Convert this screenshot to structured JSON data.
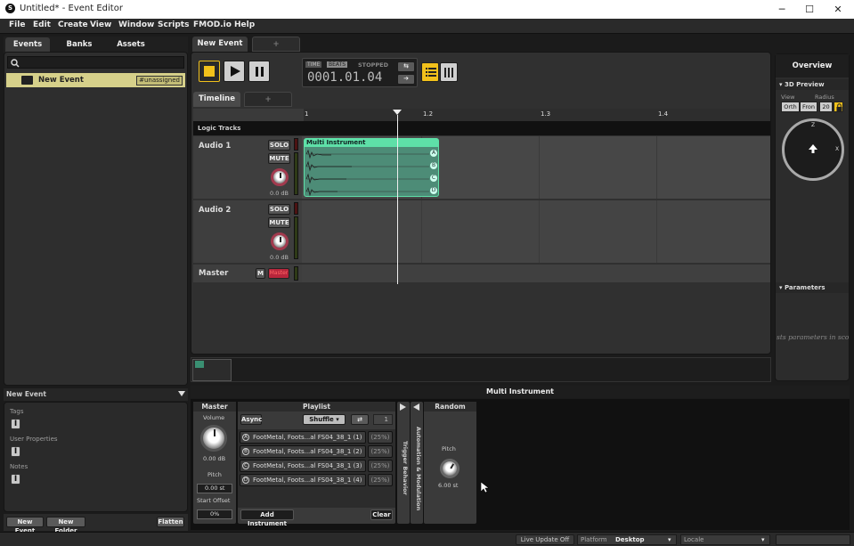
{
  "window": {
    "title": "Untitled* - Event Editor",
    "minimize": "─",
    "maximize": "☐",
    "close": "✕"
  },
  "menu": [
    "File",
    "Edit",
    "Create",
    "View",
    "Window",
    "Scripts",
    "FMOD.io",
    "Help"
  ],
  "browser": {
    "tabs": [
      "Events",
      "Banks",
      "Assets"
    ],
    "search_placeholder": "",
    "events": [
      {
        "name": "New Event",
        "badge": "#unassigned"
      }
    ],
    "properties": {
      "title": "New Event",
      "tags": "Tags",
      "user_properties": "User Properties",
      "notes": "Notes",
      "notes_icon": "I"
    },
    "footer": {
      "new_event": "New Event",
      "new_folder": "New Folder",
      "flatten": "Flatten"
    }
  },
  "editor": {
    "event_tab": "New Event",
    "add_tab": "+",
    "transport": {
      "time_label": "TIME",
      "beats_label": "BEATS",
      "status": "STOPPED",
      "position": "0001.01.04"
    },
    "timeline_tab": "Timeline",
    "timeline_add": "+",
    "ruler": [
      "1",
      "1.2",
      "1.3",
      "1.4"
    ],
    "logic_tracks": "Logic Tracks",
    "tracks": [
      {
        "name": "Audio 1",
        "solo": "SOLO",
        "mute": "MUTE",
        "level": "0.0 dB"
      },
      {
        "name": "Audio 2",
        "solo": "SOLO",
        "mute": "MUTE",
        "level": "0.0 dB"
      }
    ],
    "master": {
      "name": "Master",
      "m": "M",
      "label": "Master"
    },
    "instrument_region": {
      "name": "Multi Instrument",
      "letters": [
        "A",
        "B",
        "C",
        "D"
      ]
    }
  },
  "overview": {
    "title": "Overview",
    "preview_3d": "3D Preview",
    "view_label": "View",
    "radius_label": "Radius",
    "view_btn1": "Orth",
    "view_btn2": "Fron",
    "radius_value": "20",
    "axis_z": "Z",
    "axis_x": "X",
    "parameters": "Parameters",
    "params_hint": "sts parameters in sco"
  },
  "deck": {
    "title": "Multi Instrument",
    "master": {
      "title": "Master",
      "volume_label": "Volume",
      "volume_value": "0.00 dB",
      "pitch_label": "Pitch",
      "pitch_value": "0.00 st",
      "start_offset_label": "Start Offset",
      "start_offset_value": "0%"
    },
    "playlist": {
      "title": "Playlist",
      "async": "Async",
      "mode": "Shuffle",
      "count": "1",
      "items": [
        {
          "letter": "A",
          "name": "FootMetal, Foots...al FS04_38_1 (1)",
          "pct": "(25%)"
        },
        {
          "letter": "B",
          "name": "FootMetal, Foots...al FS04_38_1 (2)",
          "pct": "(25%)"
        },
        {
          "letter": "C",
          "name": "FootMetal, Foots...al FS04_38_1 (3)",
          "pct": "(25%)"
        },
        {
          "letter": "D",
          "name": "FootMetal, Foots...al FS04_38_1 (4)",
          "pct": "(25%)"
        }
      ],
      "add": "Add Instrument",
      "clear": "Clear"
    },
    "trigger": "Trigger Behavior",
    "automation": "Automation & Modulation",
    "random": {
      "title": "Random",
      "pitch_label": "Pitch",
      "pitch_value": "6.00 st"
    }
  },
  "statusbar": {
    "live_update": "Live Update Off",
    "platform_label": "Platform",
    "platform_value": "Desktop",
    "locale_label": "Locale",
    "locale_value": ""
  },
  "colors": {
    "accent_yellow": "#f2c11b",
    "instrument_green": "#5ee0a8",
    "knob_ring": "#a23a4e",
    "selected_event": "#d6d08a"
  }
}
